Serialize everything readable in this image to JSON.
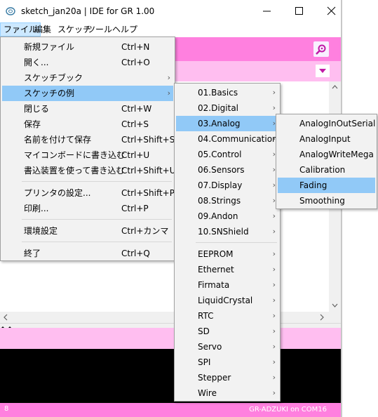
{
  "window": {
    "title": "sketch_jan20a | IDE for GR 1.00",
    "minimize_glyph": "—",
    "maximize_glyph": "☐",
    "close_glyph": "✕"
  },
  "menubar": {
    "file": "ファイル",
    "edit": "編集",
    "sketch": "スケッチ",
    "tools": "ツール",
    "help": "ヘルプ"
  },
  "file_menu": {
    "items": [
      {
        "label": "新規ファイル",
        "shortcut": "Ctrl+N"
      },
      {
        "label": "開く...",
        "shortcut": "Ctrl+O"
      },
      {
        "label": "スケッチブック",
        "shortcut": ""
      },
      {
        "label": "スケッチの例",
        "shortcut": ""
      },
      {
        "label": "閉じる",
        "shortcut": "Ctrl+W"
      },
      {
        "label": "保存",
        "shortcut": "Ctrl+S"
      },
      {
        "label": "名前を付けて保存",
        "shortcut": "Ctrl+Shift+S"
      },
      {
        "label": "マイコンボードに書き込む",
        "shortcut": "Ctrl+U"
      },
      {
        "label": "書込装置を使って書き込む",
        "shortcut": "Ctrl+Shift+U"
      },
      {
        "label": "プリンタの設定...",
        "shortcut": "Ctrl+Shift+P"
      },
      {
        "label": "印刷...",
        "shortcut": "Ctrl+P"
      },
      {
        "label": "環境設定",
        "shortcut": "Ctrl+カンマ"
      },
      {
        "label": "終了",
        "shortcut": "Ctrl+Q"
      }
    ],
    "highlighted": "スケッチの例"
  },
  "examples_menu": {
    "items": [
      "01.Basics",
      "02.Digital",
      "03.Analog",
      "04.Communication",
      "05.Control",
      "06.Sensors",
      "07.Display",
      "08.Strings",
      "09.Andon",
      "10.SNShield",
      "EEPROM",
      "Ethernet",
      "Firmata",
      "LiquidCrystal",
      "RTC",
      "SD",
      "Servo",
      "SPI",
      "Stepper",
      "Wire"
    ],
    "highlighted": "03.Analog"
  },
  "analog_menu": {
    "items": [
      "AnalogInOutSerial",
      "AnalogInput",
      "AnalogWriteMega",
      "Calibration",
      "Fading",
      "Smoothing"
    ],
    "highlighted": "Fading"
  },
  "status": {
    "line_number": "8",
    "board": "GR-ADZUKI on COM16"
  },
  "colors": {
    "toolbar": "#ff80df",
    "tabbar": "#ffbef0",
    "console": "#000000",
    "highlight": "#91c9f7"
  },
  "icons": {
    "submenu_arrow": "›",
    "serial_monitor": "serial-monitor-icon",
    "tab_menu": "chevron-down-icon"
  }
}
